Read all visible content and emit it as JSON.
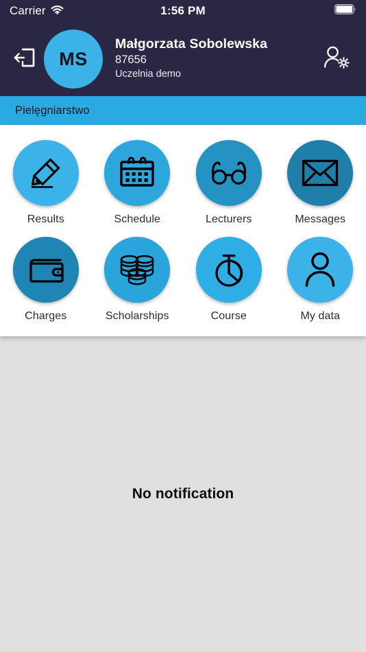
{
  "statusbar": {
    "carrier": "Carrier",
    "wifi_icon": "wifi-icon",
    "time": "1:56 PM",
    "battery_icon": "battery-full-icon"
  },
  "header": {
    "logout_icon": "logout-icon",
    "avatar_initials": "MS",
    "user_name": "Małgorzata Sobolewska",
    "user_id": "87656",
    "user_org": "Uczelnia demo",
    "settings_icon": "user-settings-icon",
    "background_color": "#2a2744",
    "avatar_color": "#3bb3e8"
  },
  "program_bar": {
    "label": "Pielęgniarstwo",
    "background_color": "#29abe2"
  },
  "menu": {
    "rows": [
      [
        {
          "label": "Results",
          "icon": "pencil-icon",
          "color": "#3bb3e8"
        },
        {
          "label": "Schedule",
          "icon": "calendar-icon",
          "color": "#2ca6dd"
        },
        {
          "label": "Lecturers",
          "icon": "glasses-icon",
          "color": "#2592c4"
        },
        {
          "label": "Messages",
          "icon": "envelope-icon",
          "color": "#1f7faa"
        }
      ],
      [
        {
          "label": "Charges",
          "icon": "wallet-icon",
          "color": "#1f85b4"
        },
        {
          "label": "Scholarships",
          "icon": "coins-icon",
          "color": "#2aa5dc"
        },
        {
          "label": "Course",
          "icon": "stopwatch-icon",
          "color": "#2eaee4"
        },
        {
          "label": "My data",
          "icon": "person-icon",
          "color": "#3bb3e8"
        }
      ]
    ]
  },
  "notifications": {
    "empty_text": "No notification",
    "background_color": "#e0e0e0"
  }
}
